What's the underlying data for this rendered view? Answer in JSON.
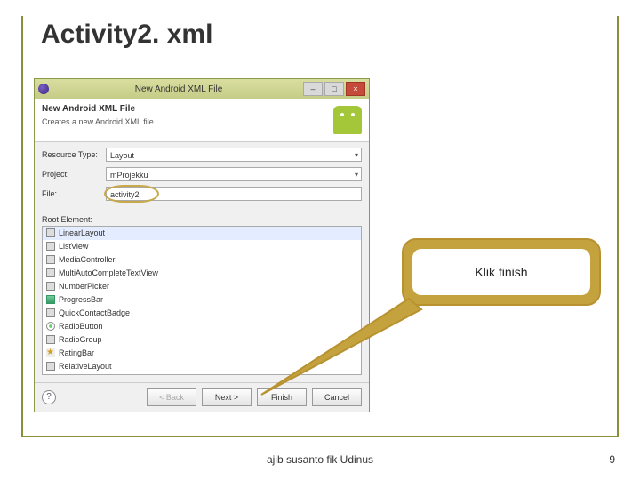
{
  "slide": {
    "title": "Activity2. xml",
    "author": "ajib susanto fik Udinus",
    "page": "9"
  },
  "dialog": {
    "window_title": "New Android XML File",
    "header_title": "New Android XML File",
    "header_sub": "Creates a new Android XML file.",
    "resource_type_label": "Resource Type:",
    "resource_type_value": "Layout",
    "project_label": "Project:",
    "project_value": "mProjekku",
    "file_label": "File:",
    "file_value": "activity2",
    "root_label": "Root Element:",
    "root_items": [
      "LinearLayout",
      "ListView",
      "MediaController",
      "MultiAutoCompleteTextView",
      "NumberPicker",
      "ProgressBar",
      "QuickContactBadge",
      "RadioButton",
      "RadioGroup",
      "RatingBar",
      "RelativeLayout"
    ],
    "btn_back": "< Back",
    "btn_next": "Next >",
    "btn_finish": "Finish",
    "btn_cancel": "Cancel",
    "win_min": "–",
    "win_max": "□",
    "win_close": "×",
    "help": "?"
  },
  "callout": {
    "text": "Klik finish"
  }
}
